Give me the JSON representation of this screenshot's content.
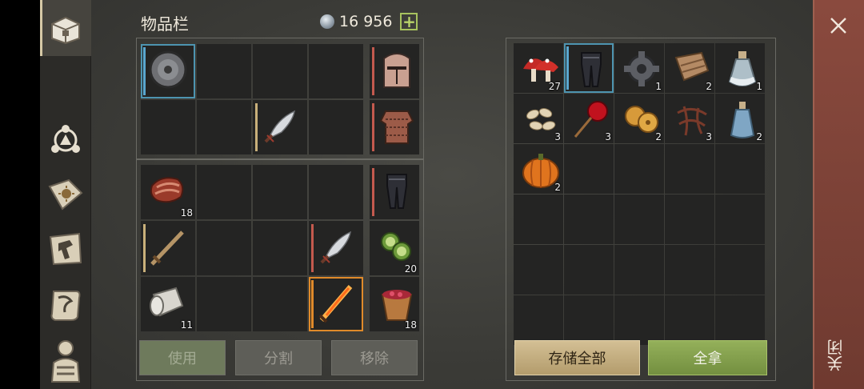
{
  "inventory": {
    "title": "物品栏",
    "currency": {
      "icon": "gem-icon",
      "amount": "16 956",
      "plus": "+"
    },
    "equipment_top": [
      {
        "name": "round-shield-icon",
        "count": "",
        "dur": "#5aa7cf",
        "sel": true
      },
      {
        "name": "empty",
        "count": ""
      },
      {
        "name": "empty",
        "count": ""
      },
      {
        "name": "empty",
        "count": ""
      },
      {
        "name": "knight-helmet-icon",
        "count": "",
        "dur": "#c45a4e"
      },
      {
        "name": "empty",
        "count": ""
      },
      {
        "name": "empty",
        "count": ""
      },
      {
        "name": "scimitar-icon",
        "count": "",
        "dur": "#c9b07a"
      },
      {
        "name": "empty",
        "count": ""
      },
      {
        "name": "chainmail-icon",
        "count": "",
        "dur": "#c45a4e"
      }
    ],
    "bag": [
      {
        "name": "raw-meat-icon",
        "count": "18"
      },
      {
        "name": "empty",
        "count": ""
      },
      {
        "name": "empty",
        "count": ""
      },
      {
        "name": "empty",
        "count": ""
      },
      {
        "name": "leggings-icon",
        "count": "",
        "dur": "#c45a4e"
      },
      {
        "name": "wooden-sword-icon",
        "count": "",
        "dur": "#c9b07a"
      },
      {
        "name": "empty",
        "count": ""
      },
      {
        "name": "empty",
        "count": ""
      },
      {
        "name": "scimitar-icon",
        "count": "",
        "dur": "#c45a4e"
      },
      {
        "name": "cucumber-slices-icon",
        "count": "20"
      },
      {
        "name": "cloth-roll-icon",
        "count": "11"
      },
      {
        "name": "empty",
        "count": ""
      },
      {
        "name": "empty",
        "count": ""
      },
      {
        "name": "flame-sword-icon",
        "count": "",
        "dur": "#e08a2a",
        "sel_orange": true
      },
      {
        "name": "berry-bucket-icon",
        "count": "18"
      }
    ],
    "buttons": {
      "use": "使用",
      "split": "分割",
      "remove": "移除"
    }
  },
  "storage": {
    "items": [
      {
        "name": "red-mushroom-icon",
        "count": "27"
      },
      {
        "name": "leggings-icon",
        "count": "",
        "dur": "#5aa7cf",
        "sel": true
      },
      {
        "name": "gear-icon",
        "count": "1"
      },
      {
        "name": "leather-scraps-icon",
        "count": "2"
      },
      {
        "name": "potion-flask-icon",
        "count": "1"
      },
      {
        "name": "seeds-icon",
        "count": "3"
      },
      {
        "name": "candied-apple-icon",
        "count": "3"
      },
      {
        "name": "cookies-icon",
        "count": "2"
      },
      {
        "name": "roots-icon",
        "count": "3"
      },
      {
        "name": "water-bottle-icon",
        "count": "2"
      },
      {
        "name": "pumpkin-icon",
        "count": "2"
      }
    ],
    "total_cells": 30,
    "buttons": {
      "store_all": "存储全部",
      "take_all": "全拿"
    }
  },
  "close": {
    "label": "关闭",
    "icon": "close-icon"
  },
  "sidebar": {
    "tabs": [
      {
        "icon": "chest-icon",
        "active": true
      },
      {
        "icon": "skills-icon"
      },
      {
        "icon": "journal-icon"
      },
      {
        "icon": "crafting-hammer-icon"
      },
      {
        "icon": "map-scroll-icon"
      },
      {
        "icon": "character-icon"
      }
    ]
  }
}
